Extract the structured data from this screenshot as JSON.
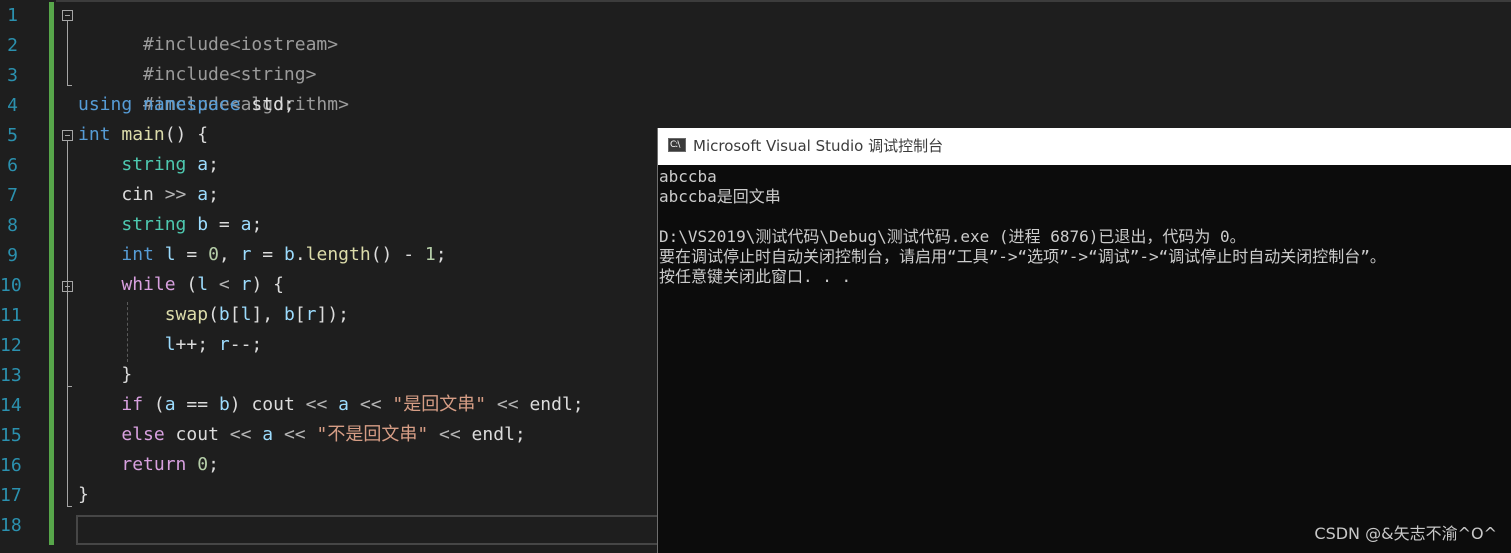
{
  "editor": {
    "line_numbers": [
      "1",
      "2",
      "3",
      "4",
      "5",
      "6",
      "7",
      "8",
      "9",
      "10",
      "11",
      "12",
      "13",
      "14",
      "15",
      "16",
      "17",
      "18"
    ],
    "code": {
      "l1": {
        "inc": "#include<iostream>"
      },
      "l2": {
        "inc": "#include<string>"
      },
      "l3": {
        "inc": "#include<algorithm>"
      },
      "l4": {
        "kw1": "using",
        "kw2": "namespace",
        "rest": " std;"
      },
      "l5": {
        "kw": "int",
        "fn": "main",
        "rest": "() {"
      },
      "l6": {
        "type": "string",
        "var": "a",
        "rest": ";"
      },
      "l7": {
        "pre": "cin ",
        "op": ">>",
        "var": "a",
        "rest": ";"
      },
      "l8": {
        "type": "string",
        "var1": "b",
        "op": " = ",
        "var2": "a",
        "rest": ";"
      },
      "l9": {
        "kw": "int",
        "var1": "l",
        "op1": " = ",
        "num1": "0",
        "sep": ", ",
        "var2": "r",
        "op2": " = ",
        "var3": "b",
        "dot": ".",
        "fn": "length",
        "mid": "() - ",
        "num2": "1",
        "rest": ";"
      },
      "l10": {
        "ctl": "while",
        "open": " (",
        "var1": "l",
        "op": " < ",
        "var2": "r",
        "rest": ") {"
      },
      "l11": {
        "fn": "swap",
        "p1": "(",
        "var1": "b",
        "p2": "[",
        "var2": "l",
        "p3": "], ",
        "var3": "b",
        "p4": "[",
        "var4": "r",
        "rest": "]);"
      },
      "l12": {
        "var1": "l",
        "op1": "++; ",
        "var2": "r",
        "rest": "--;"
      },
      "l13": {
        "text": "}"
      },
      "l14": {
        "ctl": "if",
        "open": " (",
        "var1": "a",
        "op1": " == ",
        "var2": "b",
        "mid": ") cout ",
        "op2": "<<",
        "var3": "a",
        "op3": "<<",
        "str": "\"是回文串\"",
        "op4": "<<",
        "end": " endl;"
      },
      "l15": {
        "ctl": "else",
        "mid": " cout ",
        "op1": "<<",
        "var": "a",
        "op2": "<<",
        "str": "\"不是回文串\"",
        "op3": "<<",
        "end": " endl;"
      },
      "l16": {
        "ctl": "return",
        "num": "0",
        "rest": ";"
      },
      "l17": {
        "text": "}"
      }
    }
  },
  "console": {
    "title": "Microsoft Visual Studio 调试控制台",
    "icon_text": "C:\\",
    "lines": [
      "abccba",
      "abccba是回文串",
      "",
      "D:\\VS2019\\测试代码\\Debug\\测试代码.exe (进程 6876)已退出，代码为 0。",
      "要在调试停止时自动关闭控制台，请启用“工具”->“选项”->“调试”->“调试停止时自动关闭控制台”。",
      "按任意键关闭此窗口. . ."
    ]
  },
  "watermark": "CSDN @&矢志不渝^O^",
  "colors": {
    "line_number": "#2b91af",
    "keyword": "#569cd6",
    "control": "#d8a0df",
    "type": "#4ec9b0",
    "variable": "#9cdcfe",
    "function": "#dcdcaa",
    "string": "#d69d85",
    "number": "#b5cea8",
    "change_bar": "#57a64a"
  }
}
